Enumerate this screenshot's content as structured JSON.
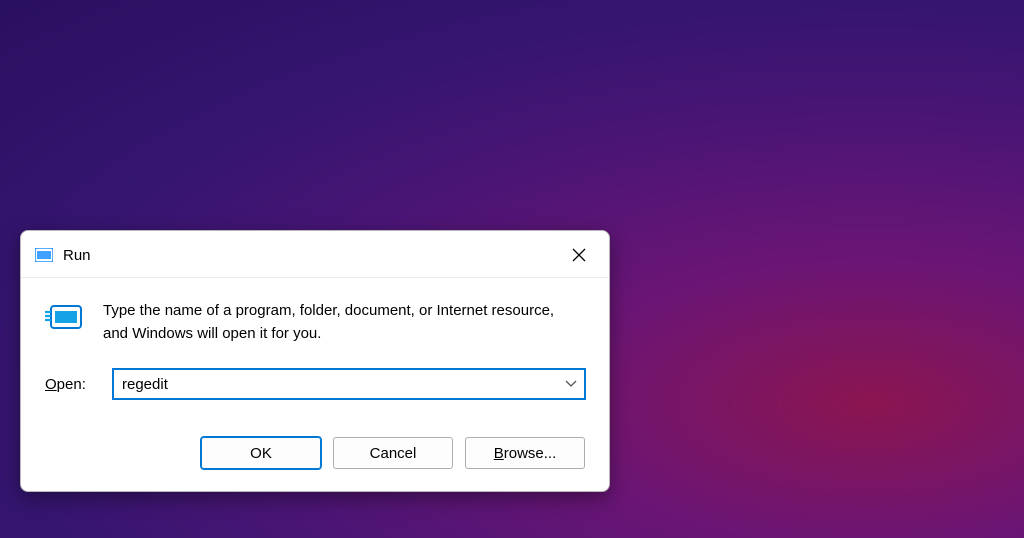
{
  "dialog": {
    "title": "Run",
    "instruction": "Type the name of a program, folder, document, or Internet resource, and Windows will open it for you.",
    "open_label_prefix": "O",
    "open_label_rest": "pen:",
    "input_value": "regedit",
    "buttons": {
      "ok": "OK",
      "cancel": "Cancel",
      "browse_prefix": "B",
      "browse_rest": "rowse..."
    }
  }
}
